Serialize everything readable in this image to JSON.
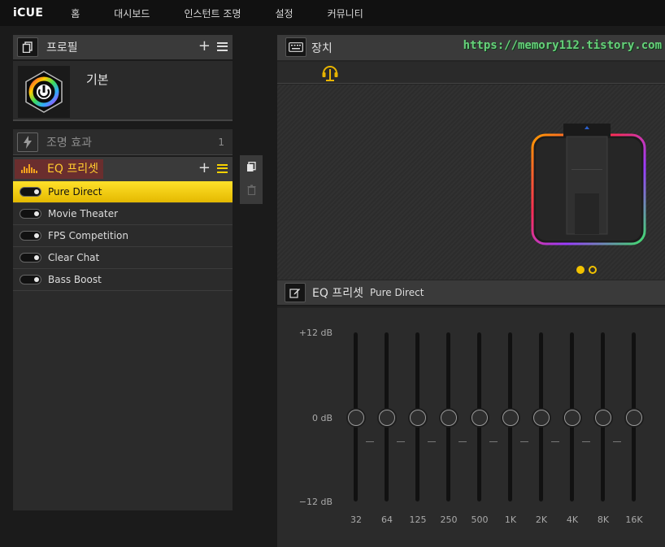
{
  "app": {
    "logo": "iCUE"
  },
  "nav": {
    "items": [
      {
        "label": "홈"
      },
      {
        "label": "대시보드"
      },
      {
        "label": "인스턴트 조명"
      },
      {
        "label": "설정"
      },
      {
        "label": "커뮤니티"
      }
    ]
  },
  "profile": {
    "header": "프로필",
    "name": "기본"
  },
  "lighting": {
    "label": "조명 효과",
    "count": "1"
  },
  "eq_list": {
    "header": "EQ 프리셋",
    "presets": [
      {
        "label": "Pure Direct",
        "active": true
      },
      {
        "label": "Movie Theater",
        "active": false
      },
      {
        "label": "FPS Competition",
        "active": false
      },
      {
        "label": "Clear Chat",
        "active": false
      },
      {
        "label": "Bass Boost",
        "active": false
      }
    ]
  },
  "devices": {
    "header": "장치",
    "watermark": "https://memory112.tistory.com",
    "page_indicator": {
      "pages": 2,
      "current": 1
    }
  },
  "eq_editor": {
    "header": "EQ 프리셋",
    "preset_name": "Pure Direct",
    "db_labels": {
      "top": "+12 dB",
      "mid": "0 dB",
      "bottom": "−12 dB"
    },
    "bands": [
      {
        "freq": "32",
        "gain_db": 0
      },
      {
        "freq": "64",
        "gain_db": 0
      },
      {
        "freq": "125",
        "gain_db": 0
      },
      {
        "freq": "250",
        "gain_db": 0
      },
      {
        "freq": "500",
        "gain_db": 0
      },
      {
        "freq": "1K",
        "gain_db": 0
      },
      {
        "freq": "2K",
        "gain_db": 0
      },
      {
        "freq": "4K",
        "gain_db": 0
      },
      {
        "freq": "8K",
        "gain_db": 0
      },
      {
        "freq": "16K",
        "gain_db": 0
      }
    ]
  },
  "colors": {
    "accent_yellow": "#f6d100",
    "eq_title": "#ffcb2e",
    "watermark": "#67d07a"
  }
}
